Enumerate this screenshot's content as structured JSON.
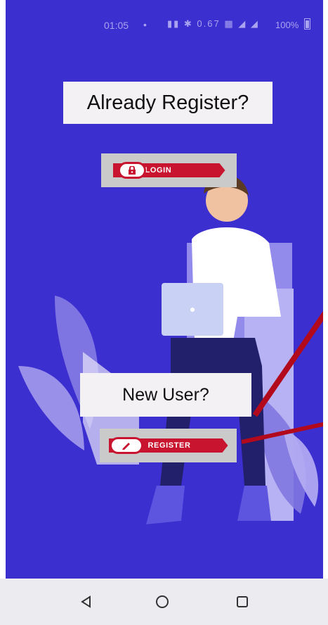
{
  "status_bar": {
    "time": "01:05",
    "dot": "•",
    "icons": "▮▮ ✱ 0.67 ▦ ◢ ◢",
    "battery": "100%"
  },
  "main": {
    "already_label": "Already Register?",
    "login_label": "LOGIN",
    "new_user_label": "New User?",
    "register_label": "REGISTER"
  },
  "nav": {
    "back_icon": "back-triangle-icon",
    "home_icon": "home-circle-icon",
    "recent_icon": "recent-square-icon"
  },
  "colors": {
    "background": "#3c2fd0",
    "accent_red": "#c8142e",
    "button_gray": "#cacaca"
  }
}
